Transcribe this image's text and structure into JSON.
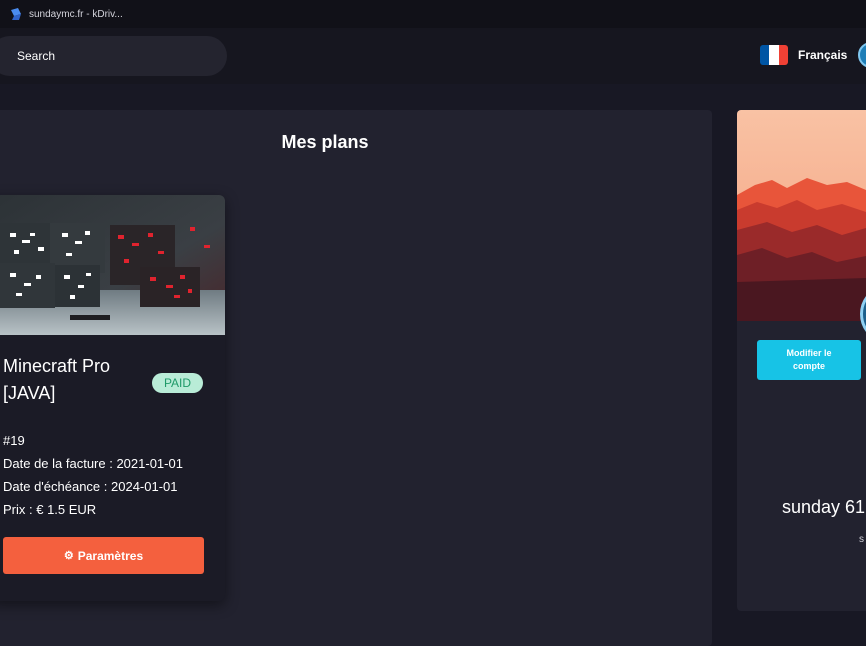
{
  "window": {
    "title": "sundaymc.fr - kDriv..."
  },
  "header": {
    "search": {
      "placeholder": "Search",
      "value": ""
    },
    "language": {
      "label": "Français",
      "flag": [
        "#0055a4",
        "#ffffff",
        "#ef4135"
      ]
    }
  },
  "plans": {
    "title": "Mes plans",
    "cards": [
      {
        "name": "Minecraft Pro [JAVA]",
        "status": "PAID",
        "id": "#19",
        "invoice_date": "Date de la facture : 2021-01-01",
        "due_date": "Date d'échéance : 2024-01-01",
        "price": "Prix : € 1.5 EUR",
        "settings_label": "Paramètres",
        "settings_icon": "gear-icon"
      }
    ]
  },
  "profile": {
    "modify_label": "Modifier le compte",
    "username": "sunday 61",
    "subtitle": "s"
  },
  "colors": {
    "accent_orange": "#f4603e",
    "accent_cyan": "#17c3e6",
    "paid_bg": "#b9ecd7",
    "paid_text": "#1f9a68"
  }
}
